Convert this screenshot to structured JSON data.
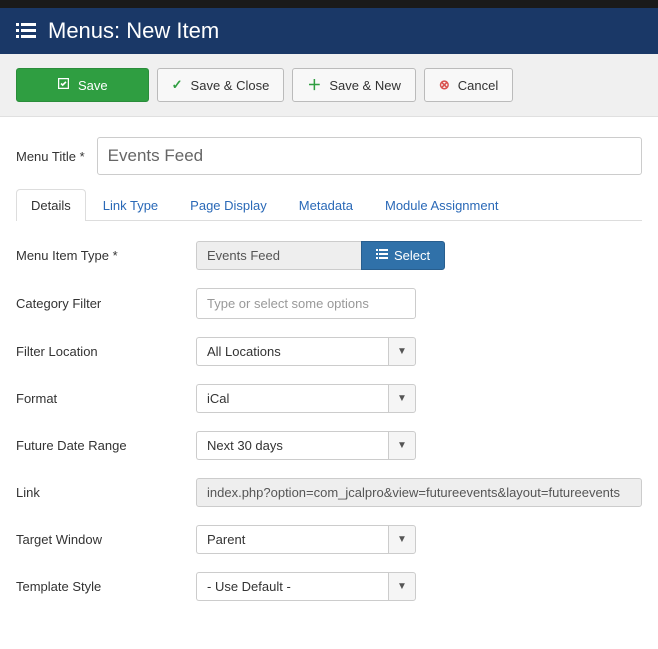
{
  "header": {
    "title": "Menus: New Item"
  },
  "toolbar": {
    "save": "Save",
    "save_close": "Save & Close",
    "save_new": "Save & New",
    "cancel": "Cancel"
  },
  "form": {
    "menu_title_label": "Menu Title *",
    "menu_title_value": "Events Feed"
  },
  "tabs": {
    "details": "Details",
    "link_type": "Link Type",
    "page_display": "Page Display",
    "metadata": "Metadata",
    "module_assignment": "Module Assignment"
  },
  "fields": {
    "menu_item_type": {
      "label": "Menu Item Type *",
      "value": "Events Feed",
      "select_btn": "Select"
    },
    "category_filter": {
      "label": "Category Filter",
      "placeholder": "Type or select some options"
    },
    "filter_location": {
      "label": "Filter Location",
      "value": "All Locations"
    },
    "format": {
      "label": "Format",
      "value": "iCal"
    },
    "future_date_range": {
      "label": "Future Date Range",
      "value": "Next 30 days"
    },
    "link": {
      "label": "Link",
      "value": "index.php?option=com_jcalpro&view=futureevents&layout=futureevents"
    },
    "target_window": {
      "label": "Target Window",
      "value": "Parent"
    },
    "template_style": {
      "label": "Template Style",
      "value": "- Use Default -"
    }
  }
}
